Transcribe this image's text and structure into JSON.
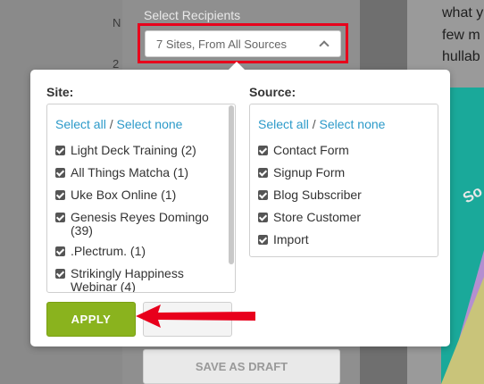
{
  "background": {
    "left_fragments": [
      "N",
      "2"
    ],
    "article_lines": [
      "what y",
      "few m",
      "hullab"
    ],
    "promo_text": "So"
  },
  "recipients": {
    "label": "Select Recipients",
    "summary": "7 Sites, From All Sources"
  },
  "popover": {
    "site": {
      "label": "Site:",
      "select_all": "Select all",
      "separator": " / ",
      "select_none": "Select none",
      "items": [
        {
          "label": "Light Deck Training (2)",
          "checked": true
        },
        {
          "label": "All Things Matcha (1)",
          "checked": true
        },
        {
          "label": "Uke Box Online (1)",
          "checked": true
        },
        {
          "label": "Genesis Reyes Domingo",
          "label2": "(39)",
          "checked": true
        },
        {
          "label": ".Plectrum. (1)",
          "checked": true
        },
        {
          "label": "Strikingly Happiness",
          "label2": "Webinar (4)",
          "checked": true
        }
      ]
    },
    "source": {
      "label": "Source:",
      "select_all": "Select all",
      "separator": " / ",
      "select_none": "Select none",
      "items": [
        {
          "label": "Contact Form",
          "checked": true
        },
        {
          "label": "Signup Form",
          "checked": true
        },
        {
          "label": "Blog Subscriber",
          "checked": true
        },
        {
          "label": "Store Customer",
          "checked": true
        },
        {
          "label": "Import",
          "checked": true
        }
      ]
    },
    "apply_label": "APPLY",
    "cancel_label": ""
  },
  "save_draft_label": "SAVE AS DRAFT",
  "colors": {
    "accent": "#8ab31e",
    "highlight": "#e8001c",
    "link": "#2c9ac9"
  }
}
